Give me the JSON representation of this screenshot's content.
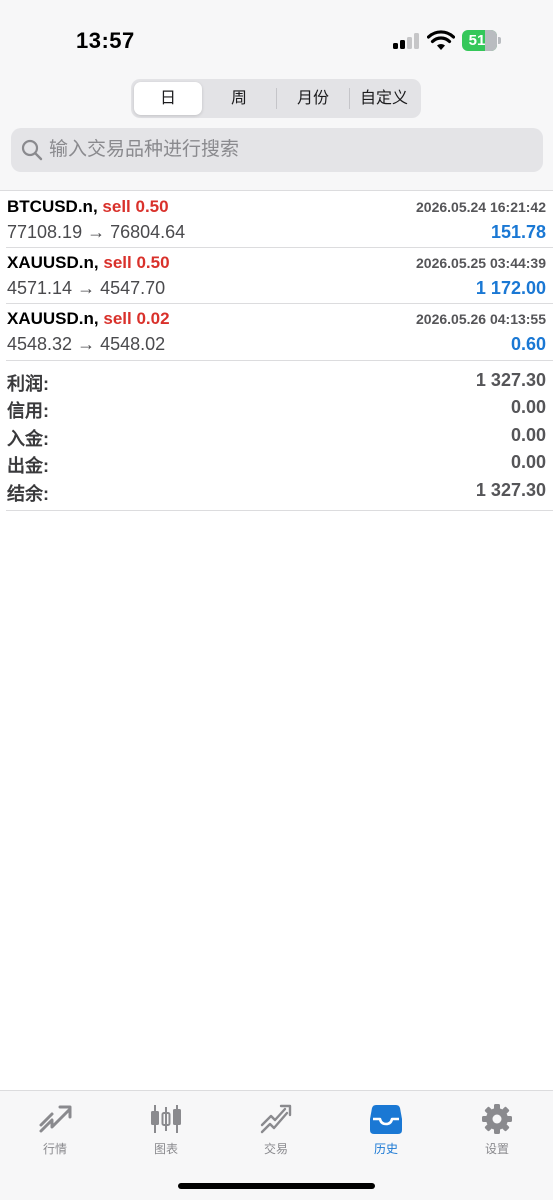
{
  "status_bar": {
    "time": "13:57",
    "battery": "51"
  },
  "period_tabs": [
    {
      "label": "日",
      "active": true
    },
    {
      "label": "周",
      "active": false
    },
    {
      "label": "月份",
      "active": false
    },
    {
      "label": "自定义",
      "active": false
    }
  ],
  "search": {
    "placeholder": "输入交易品种进行搜索",
    "value": ""
  },
  "trades": [
    {
      "symbol": "BTCUSD.n,",
      "direction": "sell 0.50",
      "time": "2026.05.24 16:21:42",
      "prices": "77108.19 → 76804.64",
      "profit": "151.78"
    },
    {
      "symbol": "XAUUSD.n,",
      "direction": "sell 0.50",
      "time": "2026.05.25 03:44:39",
      "prices": "4571.14 → 4547.70",
      "profit": "1 172.00"
    },
    {
      "symbol": "XAUUSD.n,",
      "direction": "sell 0.02",
      "time": "2026.05.26 04:13:55",
      "prices": "4548.32 → 4548.02",
      "profit": "0.60"
    }
  ],
  "summary": [
    {
      "label": "利润:",
      "value": "1 327.30"
    },
    {
      "label": "信用:",
      "value": "0.00"
    },
    {
      "label": "入金:",
      "value": "0.00"
    },
    {
      "label": "出金:",
      "value": "0.00"
    },
    {
      "label": "结余:",
      "value": "1 327.30"
    }
  ],
  "tabbar": [
    {
      "label": "行情",
      "icon": "quotes-icon",
      "active": false
    },
    {
      "label": "图表",
      "icon": "chart-candles-icon",
      "active": false
    },
    {
      "label": "交易",
      "icon": "trade-icon",
      "active": false
    },
    {
      "label": "历史",
      "icon": "history-inbox-icon",
      "active": true
    },
    {
      "label": "设置",
      "icon": "gear-icon",
      "active": false
    }
  ],
  "colors": {
    "sell": "#d9312b",
    "profit": "#1a78d4",
    "active_tab": "#1a78d4",
    "inactive_tab": "#8a8a8e",
    "battery": "#34c759"
  }
}
